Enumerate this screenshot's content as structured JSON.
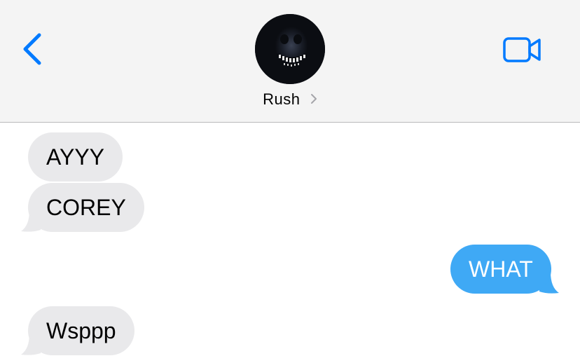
{
  "header": {
    "back_icon": "chevron-left-icon",
    "video_icon": "video-camera-icon",
    "contact_name": "Rush",
    "contact_chevron_icon": "chevron-right-icon",
    "avatar_icon": "dark-face-avatar",
    "accent_color": "#007aff"
  },
  "messages": [
    {
      "direction": "incoming",
      "text": "AYYY"
    },
    {
      "direction": "incoming",
      "text": "COREY"
    },
    {
      "direction": "outgoing",
      "text": "WHAT"
    },
    {
      "direction": "incoming",
      "text": "Wsppp"
    }
  ],
  "colors": {
    "incoming_bubble": "#e9e9eb",
    "outgoing_bubble": "#3fa9f5",
    "header_bg": "#f4f4f4"
  }
}
